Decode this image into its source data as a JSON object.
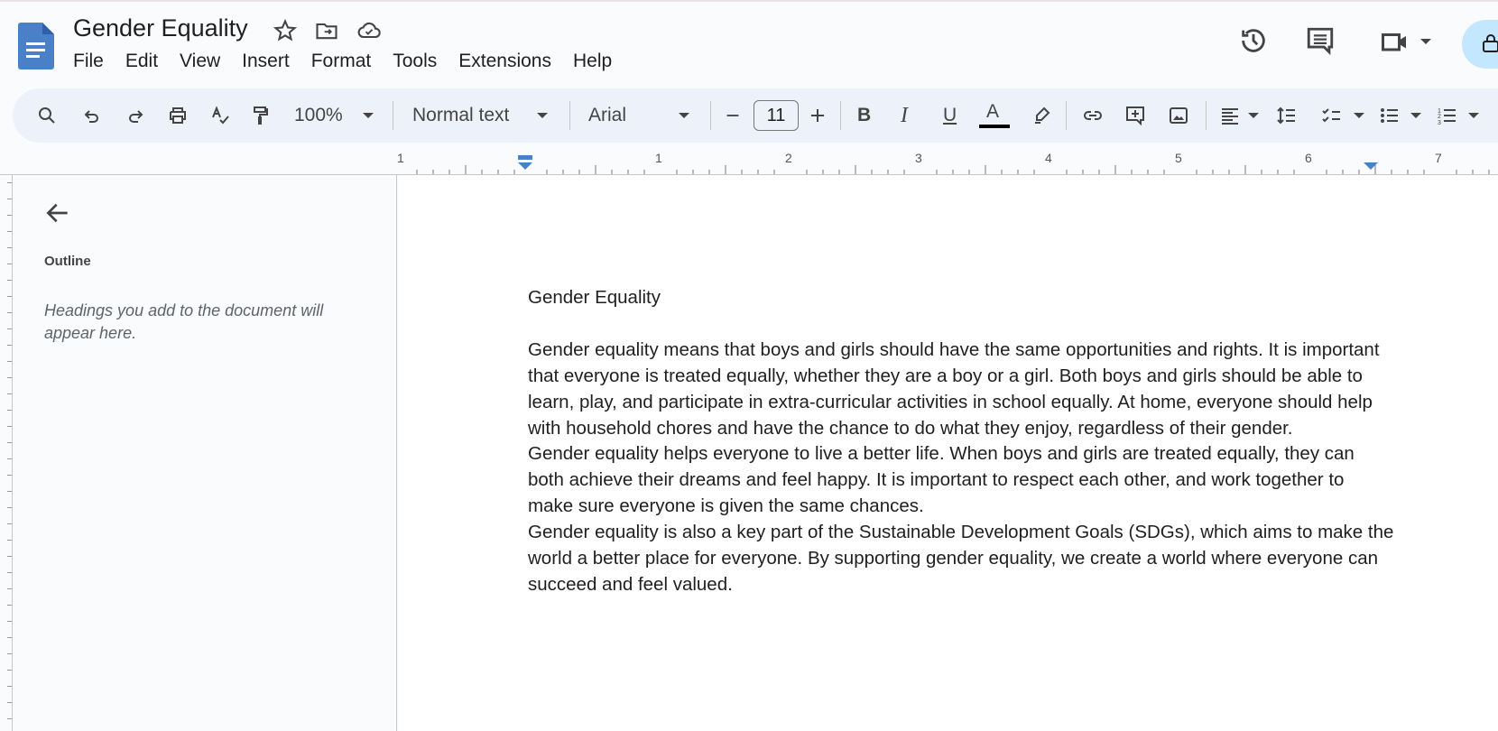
{
  "app": {
    "title": "Gender Equality"
  },
  "menu": [
    "File",
    "Edit",
    "View",
    "Insert",
    "Format",
    "Tools",
    "Extensions",
    "Help"
  ],
  "toolbar": {
    "zoom": "100%",
    "style": "Normal text",
    "font": "Arial",
    "font_size": "11",
    "bold": "B",
    "italic": "I",
    "underline": "U",
    "text_color_label": "A",
    "text_color": "#000000"
  },
  "sidebar": {
    "title": "Outline",
    "hint": "Headings you add to the document will appear here."
  },
  "ruler": {
    "labels": [
      "1",
      "1",
      "2",
      "3",
      "4",
      "5",
      "6",
      "7"
    ]
  },
  "document": {
    "title": "Gender Equality",
    "paragraphs": [
      "Gender equality means that boys and girls should have the same opportunities and rights. It is important that everyone is treated equally, whether they are a boy or a girl. Both boys and girls should be able to learn, play, and participate in extra-curricular activities in school equally. At home, everyone should help with household chores and have the chance to do what they enjoy, regardless of their gender.",
      "Gender equality helps everyone to live a better life. When boys and girls are treated equally, they can both achieve their dreams and feel happy. It is important to respect each other, and work together to make sure everyone is given the same chances.",
      "Gender equality is also a key part of the Sustainable Development Goals (SDGs), which aims to make the world a better place for everyone. By supporting gender equality, we create a world where everyone can succeed and feel valued."
    ]
  },
  "colors": {
    "accent": "#4a80c8",
    "share": "#c2e7ff",
    "toolbar_bg": "#edf2fa"
  }
}
